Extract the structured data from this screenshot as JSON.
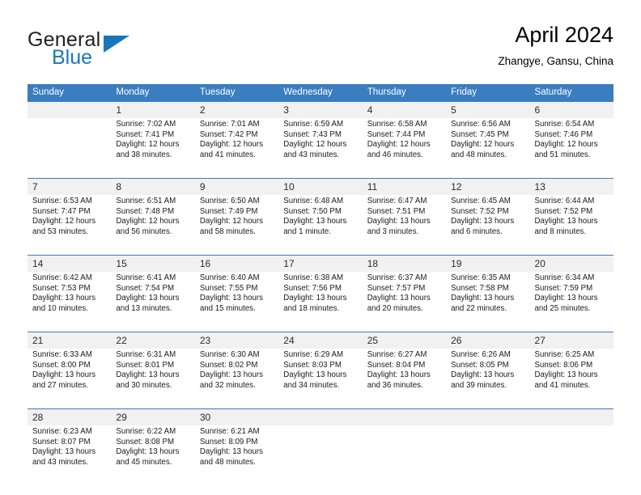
{
  "brand": {
    "name_part1": "General",
    "name_part2": "Blue",
    "accent_color": "#1a76bc"
  },
  "header": {
    "title": "April 2024",
    "subtitle": "Zhangye, Gansu, China"
  },
  "calendar": {
    "header_bg": "#3a7dc0",
    "daynum_bg": "#f1f1f1",
    "weekdays": [
      "Sunday",
      "Monday",
      "Tuesday",
      "Wednesday",
      "Thursday",
      "Friday",
      "Saturday"
    ],
    "weeks": [
      [
        {
          "day": "",
          "lines": []
        },
        {
          "day": "1",
          "lines": [
            "Sunrise: 7:02 AM",
            "Sunset: 7:41 PM",
            "Daylight: 12 hours",
            "and 38 minutes."
          ]
        },
        {
          "day": "2",
          "lines": [
            "Sunrise: 7:01 AM",
            "Sunset: 7:42 PM",
            "Daylight: 12 hours",
            "and 41 minutes."
          ]
        },
        {
          "day": "3",
          "lines": [
            "Sunrise: 6:59 AM",
            "Sunset: 7:43 PM",
            "Daylight: 12 hours",
            "and 43 minutes."
          ]
        },
        {
          "day": "4",
          "lines": [
            "Sunrise: 6:58 AM",
            "Sunset: 7:44 PM",
            "Daylight: 12 hours",
            "and 46 minutes."
          ]
        },
        {
          "day": "5",
          "lines": [
            "Sunrise: 6:56 AM",
            "Sunset: 7:45 PM",
            "Daylight: 12 hours",
            "and 48 minutes."
          ]
        },
        {
          "day": "6",
          "lines": [
            "Sunrise: 6:54 AM",
            "Sunset: 7:46 PM",
            "Daylight: 12 hours",
            "and 51 minutes."
          ]
        }
      ],
      [
        {
          "day": "7",
          "lines": [
            "Sunrise: 6:53 AM",
            "Sunset: 7:47 PM",
            "Daylight: 12 hours",
            "and 53 minutes."
          ]
        },
        {
          "day": "8",
          "lines": [
            "Sunrise: 6:51 AM",
            "Sunset: 7:48 PM",
            "Daylight: 12 hours",
            "and 56 minutes."
          ]
        },
        {
          "day": "9",
          "lines": [
            "Sunrise: 6:50 AM",
            "Sunset: 7:49 PM",
            "Daylight: 12 hours",
            "and 58 minutes."
          ]
        },
        {
          "day": "10",
          "lines": [
            "Sunrise: 6:48 AM",
            "Sunset: 7:50 PM",
            "Daylight: 13 hours",
            "and 1 minute."
          ]
        },
        {
          "day": "11",
          "lines": [
            "Sunrise: 6:47 AM",
            "Sunset: 7:51 PM",
            "Daylight: 13 hours",
            "and 3 minutes."
          ]
        },
        {
          "day": "12",
          "lines": [
            "Sunrise: 6:45 AM",
            "Sunset: 7:52 PM",
            "Daylight: 13 hours",
            "and 6 minutes."
          ]
        },
        {
          "day": "13",
          "lines": [
            "Sunrise: 6:44 AM",
            "Sunset: 7:52 PM",
            "Daylight: 13 hours",
            "and 8 minutes."
          ]
        }
      ],
      [
        {
          "day": "14",
          "lines": [
            "Sunrise: 6:42 AM",
            "Sunset: 7:53 PM",
            "Daylight: 13 hours",
            "and 10 minutes."
          ]
        },
        {
          "day": "15",
          "lines": [
            "Sunrise: 6:41 AM",
            "Sunset: 7:54 PM",
            "Daylight: 13 hours",
            "and 13 minutes."
          ]
        },
        {
          "day": "16",
          "lines": [
            "Sunrise: 6:40 AM",
            "Sunset: 7:55 PM",
            "Daylight: 13 hours",
            "and 15 minutes."
          ]
        },
        {
          "day": "17",
          "lines": [
            "Sunrise: 6:38 AM",
            "Sunset: 7:56 PM",
            "Daylight: 13 hours",
            "and 18 minutes."
          ]
        },
        {
          "day": "18",
          "lines": [
            "Sunrise: 6:37 AM",
            "Sunset: 7:57 PM",
            "Daylight: 13 hours",
            "and 20 minutes."
          ]
        },
        {
          "day": "19",
          "lines": [
            "Sunrise: 6:35 AM",
            "Sunset: 7:58 PM",
            "Daylight: 13 hours",
            "and 22 minutes."
          ]
        },
        {
          "day": "20",
          "lines": [
            "Sunrise: 6:34 AM",
            "Sunset: 7:59 PM",
            "Daylight: 13 hours",
            "and 25 minutes."
          ]
        }
      ],
      [
        {
          "day": "21",
          "lines": [
            "Sunrise: 6:33 AM",
            "Sunset: 8:00 PM",
            "Daylight: 13 hours",
            "and 27 minutes."
          ]
        },
        {
          "day": "22",
          "lines": [
            "Sunrise: 6:31 AM",
            "Sunset: 8:01 PM",
            "Daylight: 13 hours",
            "and 30 minutes."
          ]
        },
        {
          "day": "23",
          "lines": [
            "Sunrise: 6:30 AM",
            "Sunset: 8:02 PM",
            "Daylight: 13 hours",
            "and 32 minutes."
          ]
        },
        {
          "day": "24",
          "lines": [
            "Sunrise: 6:29 AM",
            "Sunset: 8:03 PM",
            "Daylight: 13 hours",
            "and 34 minutes."
          ]
        },
        {
          "day": "25",
          "lines": [
            "Sunrise: 6:27 AM",
            "Sunset: 8:04 PM",
            "Daylight: 13 hours",
            "and 36 minutes."
          ]
        },
        {
          "day": "26",
          "lines": [
            "Sunrise: 6:26 AM",
            "Sunset: 8:05 PM",
            "Daylight: 13 hours",
            "and 39 minutes."
          ]
        },
        {
          "day": "27",
          "lines": [
            "Sunrise: 6:25 AM",
            "Sunset: 8:06 PM",
            "Daylight: 13 hours",
            "and 41 minutes."
          ]
        }
      ],
      [
        {
          "day": "28",
          "lines": [
            "Sunrise: 6:23 AM",
            "Sunset: 8:07 PM",
            "Daylight: 13 hours",
            "and 43 minutes."
          ]
        },
        {
          "day": "29",
          "lines": [
            "Sunrise: 6:22 AM",
            "Sunset: 8:08 PM",
            "Daylight: 13 hours",
            "and 45 minutes."
          ]
        },
        {
          "day": "30",
          "lines": [
            "Sunrise: 6:21 AM",
            "Sunset: 8:09 PM",
            "Daylight: 13 hours",
            "and 48 minutes."
          ]
        },
        {
          "day": "",
          "lines": []
        },
        {
          "day": "",
          "lines": []
        },
        {
          "day": "",
          "lines": []
        },
        {
          "day": "",
          "lines": []
        }
      ]
    ]
  }
}
